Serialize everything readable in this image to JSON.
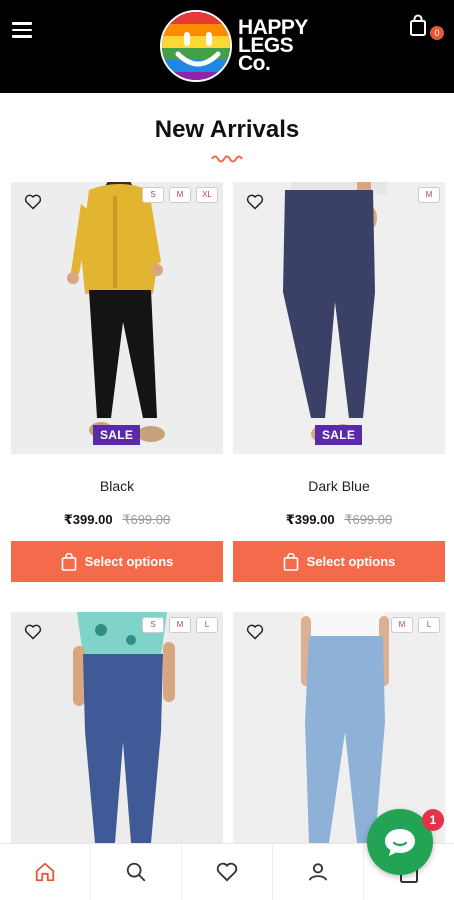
{
  "header": {
    "logo_line1": "HAPPY",
    "logo_line2": "LEGS",
    "logo_line3": "Co.",
    "cart_count": "0",
    "menu_icon": "hamburger-menu-icon",
    "cart_icon": "shopping-bag-icon"
  },
  "section": {
    "title": "New Arrivals"
  },
  "products": [
    {
      "name": "Black",
      "price": "₹399.00",
      "old_price": "₹699.00",
      "sale": "SALE",
      "sizes": [
        "S",
        "M",
        "XL"
      ],
      "button": "Select options"
    },
    {
      "name": "Dark Blue",
      "price": "₹399.00",
      "old_price": "₹699.00",
      "sale": "SALE",
      "sizes": [
        "M"
      ],
      "button": "Select options"
    },
    {
      "sizes": [
        "S",
        "M",
        "L"
      ]
    },
    {
      "sizes": [
        "M",
        "L"
      ]
    }
  ],
  "bottom_nav": {
    "icons": [
      "home-icon",
      "search-icon",
      "heart-icon",
      "user-icon",
      "bag-icon"
    ]
  },
  "chat": {
    "badge": "1"
  },
  "colors": {
    "header_bg": "#000000",
    "accent": "#f36b4b",
    "sale_bg": "#5b2aa8",
    "chat_green": "#23a455"
  }
}
